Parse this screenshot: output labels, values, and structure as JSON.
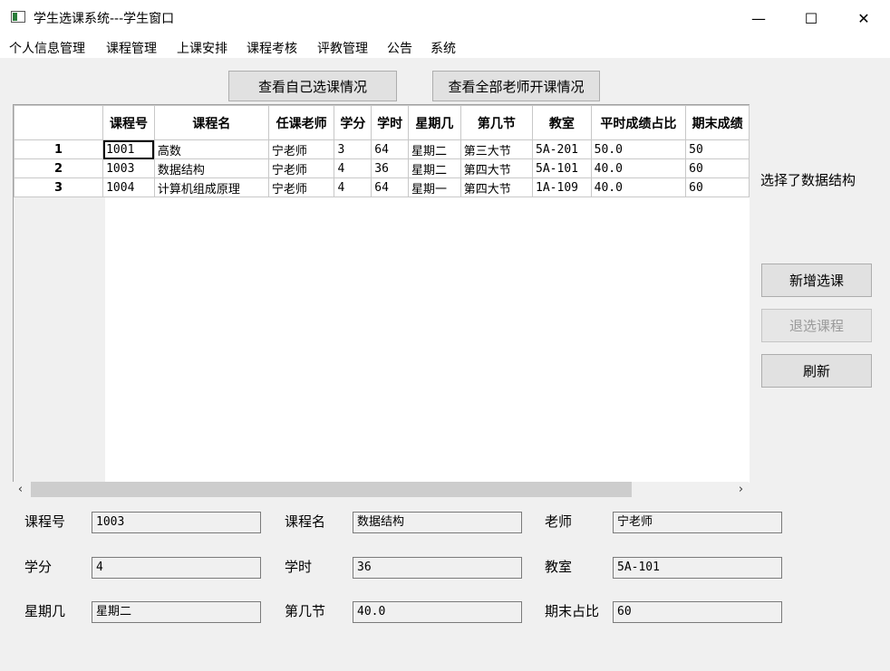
{
  "window": {
    "title": "学生选课系统---学生窗口",
    "min_glyph": "—",
    "max_glyph": "☐",
    "close_glyph": "✕"
  },
  "menu": [
    "个人信息管理",
    "课程管理",
    "上课安排",
    "课程考核",
    "评教管理",
    "公告",
    "系统"
  ],
  "toolbar": {
    "my_selection": "查看自己选课情况",
    "all_courses": "查看全部老师开课情况"
  },
  "table": {
    "headers": [
      "课程号",
      "课程名",
      "任课老师",
      "学分",
      "学时",
      "星期几",
      "第几节",
      "教室",
      "平时成绩占比",
      "期末成绩"
    ],
    "rows": [
      {
        "num": "1",
        "cells": [
          "1001",
          "高数",
          "宁老师",
          "3",
          "64",
          "星期二",
          "第三大节",
          "5A-201",
          "50.0",
          "50"
        ]
      },
      {
        "num": "2",
        "cells": [
          "1003",
          "数据结构",
          "宁老师",
          "4",
          "36",
          "星期二",
          "第四大节",
          "5A-101",
          "40.0",
          "60"
        ]
      },
      {
        "num": "3",
        "cells": [
          "1004",
          "计算机组成原理",
          "宁老师",
          "4",
          "64",
          "星期一",
          "第四大节",
          "1A-109",
          "40.0",
          "60"
        ]
      }
    ]
  },
  "scroll": {
    "left": "‹",
    "right": "›"
  },
  "side": {
    "status": "选择了数据结构",
    "add": "新增选课",
    "drop": "退选课程",
    "refresh": "刷新"
  },
  "form": {
    "course_id_label": "课程号",
    "course_id": "1003",
    "course_name_label": "课程名",
    "course_name": "数据结构",
    "teacher_label": "老师",
    "teacher": "宁老师",
    "credit_label": "学分",
    "credit": "4",
    "hours_label": "学时",
    "hours": "36",
    "room_label": "教室",
    "room": "5A-101",
    "weekday_label": "星期几",
    "weekday": "星期二",
    "period_label": "第几节",
    "period": "40.0",
    "final_ratio_label": "期末占比",
    "final_ratio": "60"
  }
}
